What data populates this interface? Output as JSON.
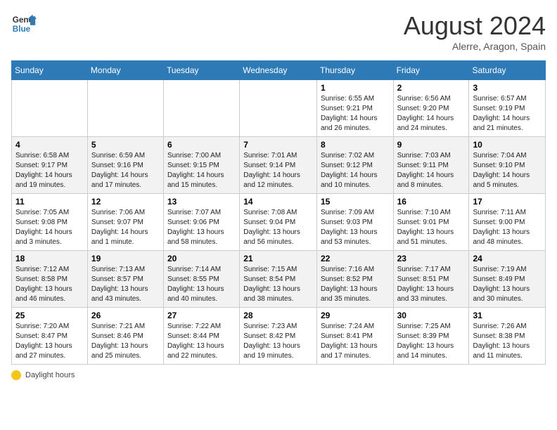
{
  "header": {
    "logo_line1": "General",
    "logo_line2": "Blue",
    "month_title": "August 2024",
    "location": "Alerre, Aragon, Spain"
  },
  "legend": {
    "icon_name": "sun-icon",
    "label": "Daylight hours"
  },
  "days_of_week": [
    "Sunday",
    "Monday",
    "Tuesday",
    "Wednesday",
    "Thursday",
    "Friday",
    "Saturday"
  ],
  "weeks": [
    [
      {
        "day": "",
        "info": ""
      },
      {
        "day": "",
        "info": ""
      },
      {
        "day": "",
        "info": ""
      },
      {
        "day": "",
        "info": ""
      },
      {
        "day": "1",
        "info": "Sunrise: 6:55 AM\nSunset: 9:21 PM\nDaylight: 14 hours\nand 26 minutes."
      },
      {
        "day": "2",
        "info": "Sunrise: 6:56 AM\nSunset: 9:20 PM\nDaylight: 14 hours\nand 24 minutes."
      },
      {
        "day": "3",
        "info": "Sunrise: 6:57 AM\nSunset: 9:19 PM\nDaylight: 14 hours\nand 21 minutes."
      }
    ],
    [
      {
        "day": "4",
        "info": "Sunrise: 6:58 AM\nSunset: 9:17 PM\nDaylight: 14 hours\nand 19 minutes."
      },
      {
        "day": "5",
        "info": "Sunrise: 6:59 AM\nSunset: 9:16 PM\nDaylight: 14 hours\nand 17 minutes."
      },
      {
        "day": "6",
        "info": "Sunrise: 7:00 AM\nSunset: 9:15 PM\nDaylight: 14 hours\nand 15 minutes."
      },
      {
        "day": "7",
        "info": "Sunrise: 7:01 AM\nSunset: 9:14 PM\nDaylight: 14 hours\nand 12 minutes."
      },
      {
        "day": "8",
        "info": "Sunrise: 7:02 AM\nSunset: 9:12 PM\nDaylight: 14 hours\nand 10 minutes."
      },
      {
        "day": "9",
        "info": "Sunrise: 7:03 AM\nSunset: 9:11 PM\nDaylight: 14 hours\nand 8 minutes."
      },
      {
        "day": "10",
        "info": "Sunrise: 7:04 AM\nSunset: 9:10 PM\nDaylight: 14 hours\nand 5 minutes."
      }
    ],
    [
      {
        "day": "11",
        "info": "Sunrise: 7:05 AM\nSunset: 9:08 PM\nDaylight: 14 hours\nand 3 minutes."
      },
      {
        "day": "12",
        "info": "Sunrise: 7:06 AM\nSunset: 9:07 PM\nDaylight: 14 hours\nand 1 minute."
      },
      {
        "day": "13",
        "info": "Sunrise: 7:07 AM\nSunset: 9:06 PM\nDaylight: 13 hours\nand 58 minutes."
      },
      {
        "day": "14",
        "info": "Sunrise: 7:08 AM\nSunset: 9:04 PM\nDaylight: 13 hours\nand 56 minutes."
      },
      {
        "day": "15",
        "info": "Sunrise: 7:09 AM\nSunset: 9:03 PM\nDaylight: 13 hours\nand 53 minutes."
      },
      {
        "day": "16",
        "info": "Sunrise: 7:10 AM\nSunset: 9:01 PM\nDaylight: 13 hours\nand 51 minutes."
      },
      {
        "day": "17",
        "info": "Sunrise: 7:11 AM\nSunset: 9:00 PM\nDaylight: 13 hours\nand 48 minutes."
      }
    ],
    [
      {
        "day": "18",
        "info": "Sunrise: 7:12 AM\nSunset: 8:58 PM\nDaylight: 13 hours\nand 46 minutes."
      },
      {
        "day": "19",
        "info": "Sunrise: 7:13 AM\nSunset: 8:57 PM\nDaylight: 13 hours\nand 43 minutes."
      },
      {
        "day": "20",
        "info": "Sunrise: 7:14 AM\nSunset: 8:55 PM\nDaylight: 13 hours\nand 40 minutes."
      },
      {
        "day": "21",
        "info": "Sunrise: 7:15 AM\nSunset: 8:54 PM\nDaylight: 13 hours\nand 38 minutes."
      },
      {
        "day": "22",
        "info": "Sunrise: 7:16 AM\nSunset: 8:52 PM\nDaylight: 13 hours\nand 35 minutes."
      },
      {
        "day": "23",
        "info": "Sunrise: 7:17 AM\nSunset: 8:51 PM\nDaylight: 13 hours\nand 33 minutes."
      },
      {
        "day": "24",
        "info": "Sunrise: 7:19 AM\nSunset: 8:49 PM\nDaylight: 13 hours\nand 30 minutes."
      }
    ],
    [
      {
        "day": "25",
        "info": "Sunrise: 7:20 AM\nSunset: 8:47 PM\nDaylight: 13 hours\nand 27 minutes."
      },
      {
        "day": "26",
        "info": "Sunrise: 7:21 AM\nSunset: 8:46 PM\nDaylight: 13 hours\nand 25 minutes."
      },
      {
        "day": "27",
        "info": "Sunrise: 7:22 AM\nSunset: 8:44 PM\nDaylight: 13 hours\nand 22 minutes."
      },
      {
        "day": "28",
        "info": "Sunrise: 7:23 AM\nSunset: 8:42 PM\nDaylight: 13 hours\nand 19 minutes."
      },
      {
        "day": "29",
        "info": "Sunrise: 7:24 AM\nSunset: 8:41 PM\nDaylight: 13 hours\nand 17 minutes."
      },
      {
        "day": "30",
        "info": "Sunrise: 7:25 AM\nSunset: 8:39 PM\nDaylight: 13 hours\nand 14 minutes."
      },
      {
        "day": "31",
        "info": "Sunrise: 7:26 AM\nSunset: 8:38 PM\nDaylight: 13 hours\nand 11 minutes."
      }
    ]
  ]
}
